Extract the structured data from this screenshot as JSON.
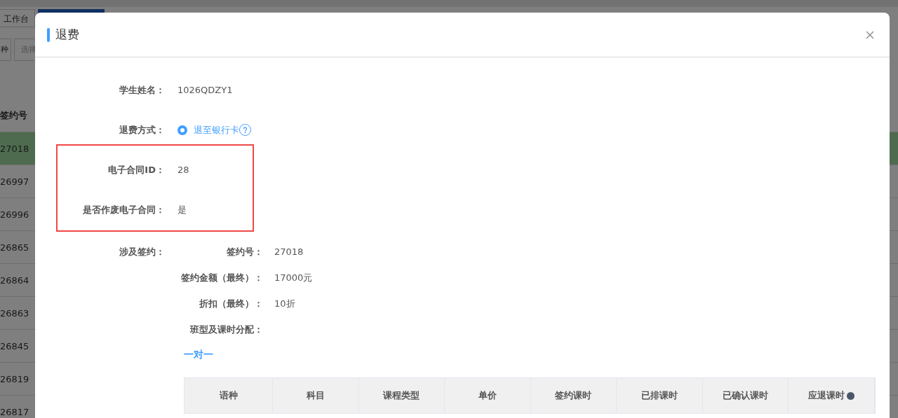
{
  "page": {
    "tabs": [
      {
        "label": "工作台",
        "selected": false
      },
      {
        "selected": true
      }
    ],
    "filters": [
      {
        "value": "种"
      },
      {
        "placeholder": "选择"
      }
    ],
    "table": {
      "columns": [
        {
          "label": "签约号"
        }
      ],
      "rows": [
        {
          "cells": [
            "27018"
          ],
          "selected": true
        },
        {
          "cells": [
            "26997"
          ],
          "selected": false
        },
        {
          "cells": [
            "26996"
          ],
          "selected": false
        },
        {
          "cells": [
            "26865"
          ],
          "selected": false
        },
        {
          "cells": [
            "26864"
          ],
          "selected": false
        },
        {
          "cells": [
            "26863"
          ],
          "selected": false
        },
        {
          "cells": [
            "26845"
          ],
          "selected": false
        },
        {
          "cells": [
            "26819"
          ],
          "selected": false
        },
        {
          "cells": [
            "26817"
          ],
          "selected": false
        }
      ]
    }
  },
  "dialog": {
    "title": "退费",
    "close": true,
    "form": [
      {
        "kind": "text",
        "label": "学生姓名：",
        "value": "1026QDZY1"
      },
      {
        "kind": "radio",
        "label": "退费方式：",
        "options": [
          {
            "label": "退至银行卡",
            "selected": true,
            "help": true
          }
        ]
      },
      {
        "kind": "group",
        "highlighted": true,
        "rows": [
          {
            "label": "电子合同ID：",
            "value": "28"
          },
          {
            "label": "是否作废电子合同：",
            "value": "是"
          }
        ]
      },
      {
        "kind": "contract",
        "label": "涉及签约：",
        "rows": [
          {
            "label": "签约号：",
            "value": "27018"
          },
          {
            "label": "签约金额（最终）：",
            "value": "17000元"
          },
          {
            "label": "折扣（最终）：",
            "value": "10折"
          },
          {
            "label": "班型及课时分配："
          }
        ]
      }
    ],
    "allocation": {
      "title": "一对一",
      "columns": [
        {
          "label": "语种"
        },
        {
          "label": "科目"
        },
        {
          "label": "课程类型"
        },
        {
          "label": "单价"
        },
        {
          "label": "签约课时"
        },
        {
          "label": "已排课时"
        },
        {
          "label": "已确认课时"
        },
        {
          "label": "应退课时",
          "help": true
        }
      ]
    }
  }
}
